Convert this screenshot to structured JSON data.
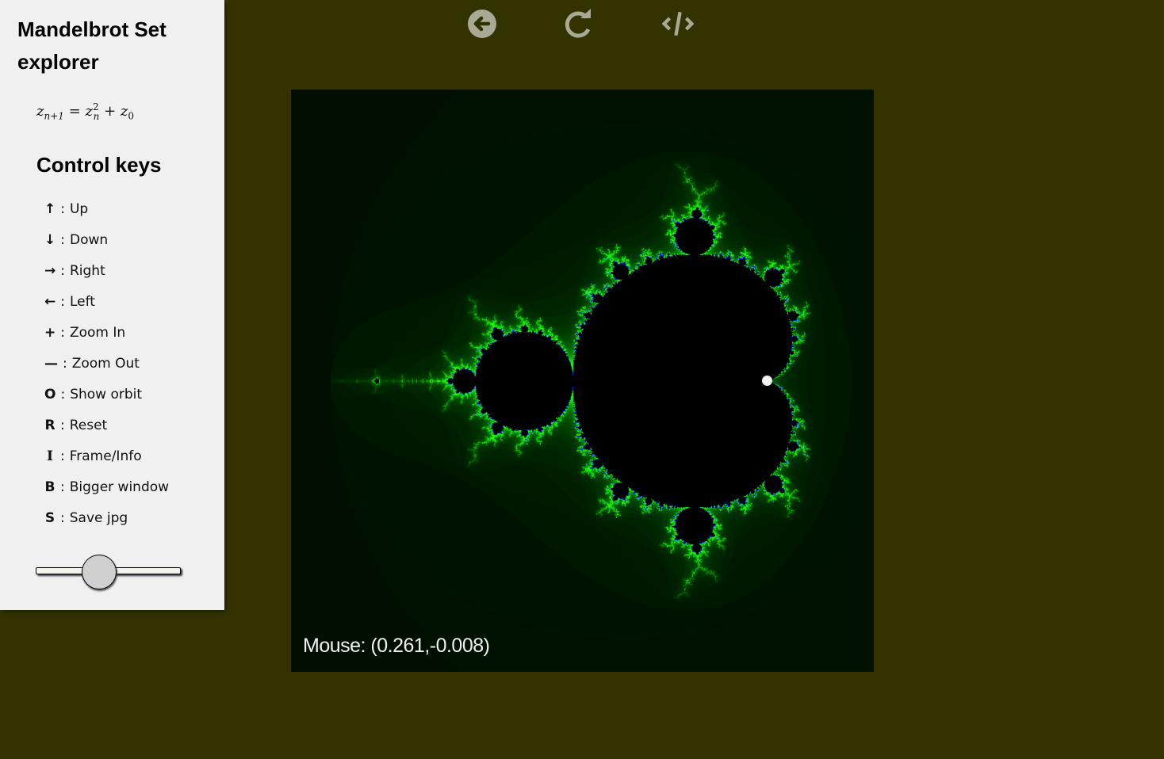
{
  "sidebar": {
    "title": "Mandelbrot Set explorer",
    "formula": {
      "lhs_var": "z",
      "lhs_sub": "n+1",
      "equals": "=",
      "rhs_var": "z",
      "rhs_sub": "n",
      "rhs_sup": "2",
      "plus": "+",
      "const_var": "z",
      "const_sub": "0"
    },
    "keys_heading": "Control keys",
    "keys": [
      {
        "key": "↑",
        "icon": "arrow-up-icon",
        "label": "Up"
      },
      {
        "key": "↓",
        "icon": "arrow-down-icon",
        "label": "Down"
      },
      {
        "key": "→",
        "icon": "arrow-right-icon",
        "label": "Right"
      },
      {
        "key": "←",
        "icon": "arrow-left-icon",
        "label": "Left"
      },
      {
        "key": "+",
        "icon": "plus-icon",
        "label": "Zoom In"
      },
      {
        "key": "—",
        "icon": "minus-icon",
        "label": "Zoom Out"
      },
      {
        "key": "O",
        "label": "Show orbit"
      },
      {
        "key": "R",
        "label": "Reset"
      },
      {
        "key": "I",
        "label": "Frame/Info"
      },
      {
        "key": "B",
        "label": "Bigger window"
      },
      {
        "key": "S",
        "label": "Save jpg"
      }
    ],
    "separator": ":",
    "slider": {
      "value_fraction": 0.42
    }
  },
  "toolbar": {
    "back": {
      "icon": "arrow-circle-left-icon"
    },
    "redo": {
      "icon": "redo-icon"
    },
    "code": {
      "icon": "code-icon"
    }
  },
  "viewer": {
    "mouse_readout": "Mouse: (0.261,-0.008)",
    "view": {
      "x_min": -2.2,
      "x_max": 0.8,
      "y_min": -1.5,
      "y_max": 1.5
    },
    "orbit_point": {
      "re": 0.25,
      "im": 0.0
    },
    "colors": {
      "page_background": "#333300",
      "set_interior": "#000000",
      "glow": "#00ff00",
      "edge_accent": "#0000ff",
      "orbit_dot": "#f2f2f2"
    }
  }
}
